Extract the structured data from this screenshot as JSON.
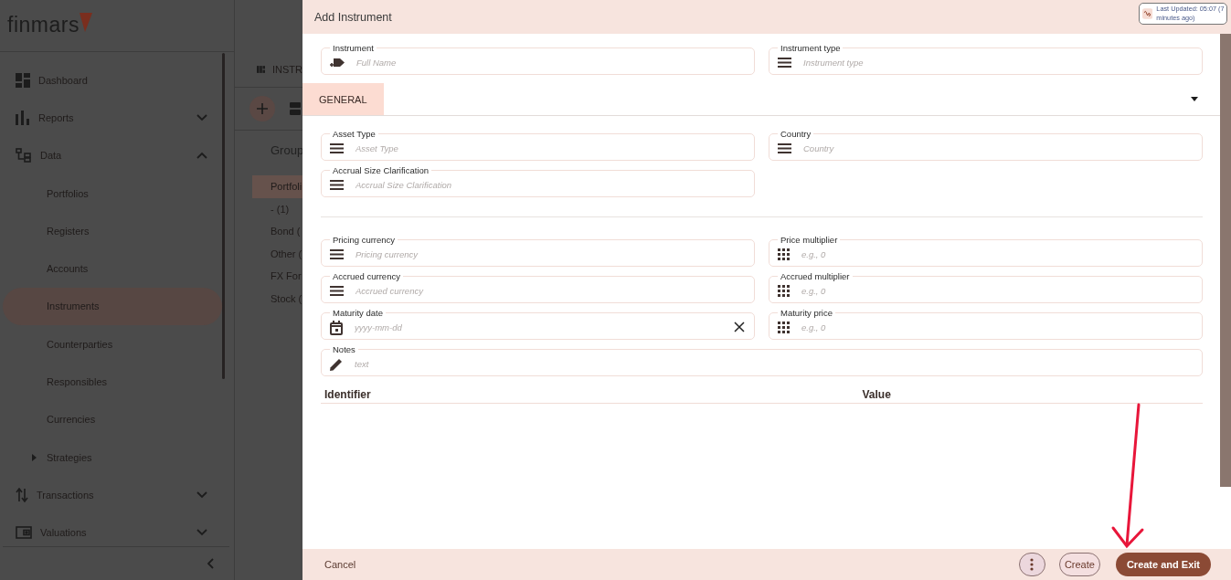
{
  "sidebar": {
    "logo": "finmars",
    "items": [
      {
        "label": "Dashboard",
        "selected": false
      },
      {
        "label": "Reports",
        "selected": false,
        "expanded": false
      },
      {
        "label": "Data",
        "selected": false,
        "expanded": true,
        "children": [
          {
            "label": "Portfolios",
            "selected": false
          },
          {
            "label": "Registers",
            "selected": false
          },
          {
            "label": "Accounts",
            "selected": false
          },
          {
            "label": "Instruments",
            "selected": true
          },
          {
            "label": "Counterparties",
            "selected": false
          },
          {
            "label": "Responsibles",
            "selected": false
          },
          {
            "label": "Currencies",
            "selected": false
          },
          {
            "label": "Strategies",
            "selected": false,
            "expanded": false
          }
        ]
      },
      {
        "label": "Transactions",
        "selected": false,
        "expanded": false
      },
      {
        "label": "Valuations",
        "selected": false,
        "expanded": false
      }
    ]
  },
  "list_panel": {
    "title": "INSTR",
    "group_header": "Group",
    "groups": [
      {
        "label": "Portfoli",
        "selected": true
      },
      {
        "label": "- (1)",
        "selected": false
      },
      {
        "label": "Bond (",
        "selected": false
      },
      {
        "label": "Other (",
        "selected": false
      },
      {
        "label": "FX For",
        "selected": false
      },
      {
        "label": "Stock (",
        "selected": false
      }
    ]
  },
  "dialog": {
    "title": "Add Instrument",
    "last_updated": "Last Updated: 05:07 (7 minutes ago)",
    "top_fields": [
      {
        "kind": "instrument",
        "label": "Instrument",
        "placeholder": "Full Name"
      },
      {
        "kind": "select",
        "label": "Instrument type",
        "placeholder": "Instrument type"
      }
    ],
    "tabs": [
      {
        "label": "GENERAL",
        "selected": true
      }
    ],
    "sections": [
      {
        "fields": [
          {
            "kind": "select",
            "label": "Asset Type",
            "placeholder": "Asset Type"
          },
          {
            "kind": "select",
            "label": "Country",
            "placeholder": "Country"
          },
          {
            "kind": "select",
            "label": "Accrual Size Clarification",
            "placeholder": "Accrual Size Clarification"
          }
        ]
      },
      {
        "fields": [
          {
            "kind": "select",
            "label": "Pricing currency",
            "placeholder": "Pricing currency"
          },
          {
            "kind": "number",
            "label": "Price multiplier",
            "placeholder": "e.g., 0"
          },
          {
            "kind": "select",
            "label": "Accrued currency",
            "placeholder": "Accrued currency"
          },
          {
            "kind": "number",
            "label": "Accrued multiplier",
            "placeholder": "e.g., 0"
          },
          {
            "kind": "date",
            "label": "Maturity date",
            "placeholder": "yyyy-mm-dd"
          },
          {
            "kind": "number",
            "label": "Maturity price",
            "placeholder": "e.g., 0"
          },
          {
            "kind": "text",
            "label": "Notes",
            "placeholder": "text",
            "wide": true
          }
        ]
      }
    ],
    "table": {
      "columns": [
        "Identifier",
        "Value"
      ]
    },
    "footer": {
      "cancel": "Cancel",
      "create": "Create",
      "create_and_exit": "Create and Exit"
    }
  }
}
